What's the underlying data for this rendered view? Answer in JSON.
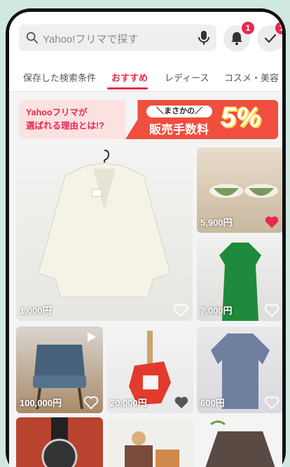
{
  "search": {
    "placeholder": "Yahoo!フリマで探す"
  },
  "notifications": {
    "badge": "1"
  },
  "todo": {
    "badge": "1"
  },
  "tabs": [
    "保存した検索条件",
    "おすすめ",
    "レディース",
    "コスメ・美容"
  ],
  "banner": {
    "line1": "Yahooフリマが",
    "line2": "選ばれる理由とは!?",
    "tag": "＼まさかの／",
    "fee_label": "販売手数料",
    "fee_value": "5%"
  },
  "items": [
    {
      "price": "1,000円",
      "liked": false
    },
    {
      "price": "5,900円",
      "liked": true
    },
    {
      "price": "7,000円",
      "liked": false
    },
    {
      "price": "100,000円",
      "liked": false
    },
    {
      "price": "20,000円",
      "liked": false
    },
    {
      "price": "600円",
      "liked": false
    }
  ],
  "colors": {
    "accent": "#e8284f",
    "background": "#cfe9e2"
  }
}
